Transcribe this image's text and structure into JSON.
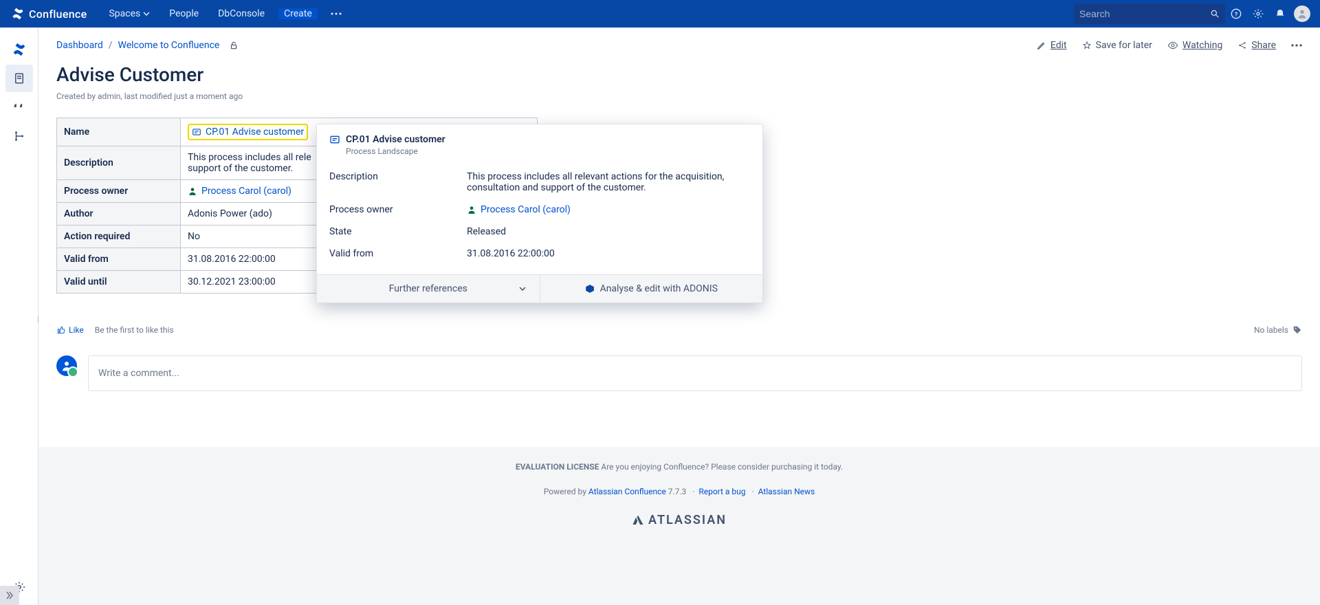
{
  "header": {
    "app_name": "Confluence",
    "nav": {
      "spaces": "Spaces",
      "people": "People",
      "dbconsole": "DbConsole"
    },
    "create": "Create",
    "search_placeholder": "Search"
  },
  "breadcrumb": {
    "dashboard": "Dashboard",
    "welcome": "Welcome to Confluence"
  },
  "actions": {
    "edit": "Edit",
    "save": "Save for later",
    "watching": "Watching",
    "share": "Share"
  },
  "page": {
    "title": "Advise Customer",
    "meta": "Created by admin, last modified just a moment ago"
  },
  "table": {
    "rows": {
      "name_label": "Name",
      "name_value": "CP.01 Advise customer",
      "desc_label": "Description",
      "desc_value": "This process includes all rele\nsupport of the customer.",
      "owner_label": "Process owner",
      "owner_value": "Process Carol (carol)",
      "author_label": "Author",
      "author_value": "Adonis Power (ado)",
      "action_label": "Action required",
      "action_value": "No",
      "validfrom_label": "Valid from",
      "validfrom_value": "31.08.2016 22:00:00",
      "validuntil_label": "Valid until",
      "validuntil_value": "30.12.2021 23:00:00"
    }
  },
  "popover": {
    "title": "CP.01 Advise customer",
    "subtitle": "Process Landscape",
    "desc_label": "Description",
    "desc_value": "This process includes all relevant actions for the acquisition, consultation and support of the customer.",
    "owner_label": "Process owner",
    "owner_value": "Process Carol (carol)",
    "state_label": "State",
    "state_value": "Released",
    "validfrom_label": "Valid from",
    "validfrom_value": "31.08.2016 22:00:00",
    "further": "Further references",
    "analyse": "Analyse & edit with ADONIS"
  },
  "like": {
    "like": "Like",
    "first": "Be the first to like this",
    "nolabels": "No labels"
  },
  "comment": {
    "placeholder": "Write a comment..."
  },
  "footer": {
    "eval_strong": "EVALUATION LICENSE",
    "eval_rest": " Are you enjoying Confluence? Please consider purchasing it today.",
    "powered_pre": "Powered by ",
    "atl_conf": "Atlassian Confluence",
    "version": " 7.7.3",
    "bug": "Report a bug",
    "news": "Atlassian News",
    "brand": "ATLASSIAN"
  }
}
